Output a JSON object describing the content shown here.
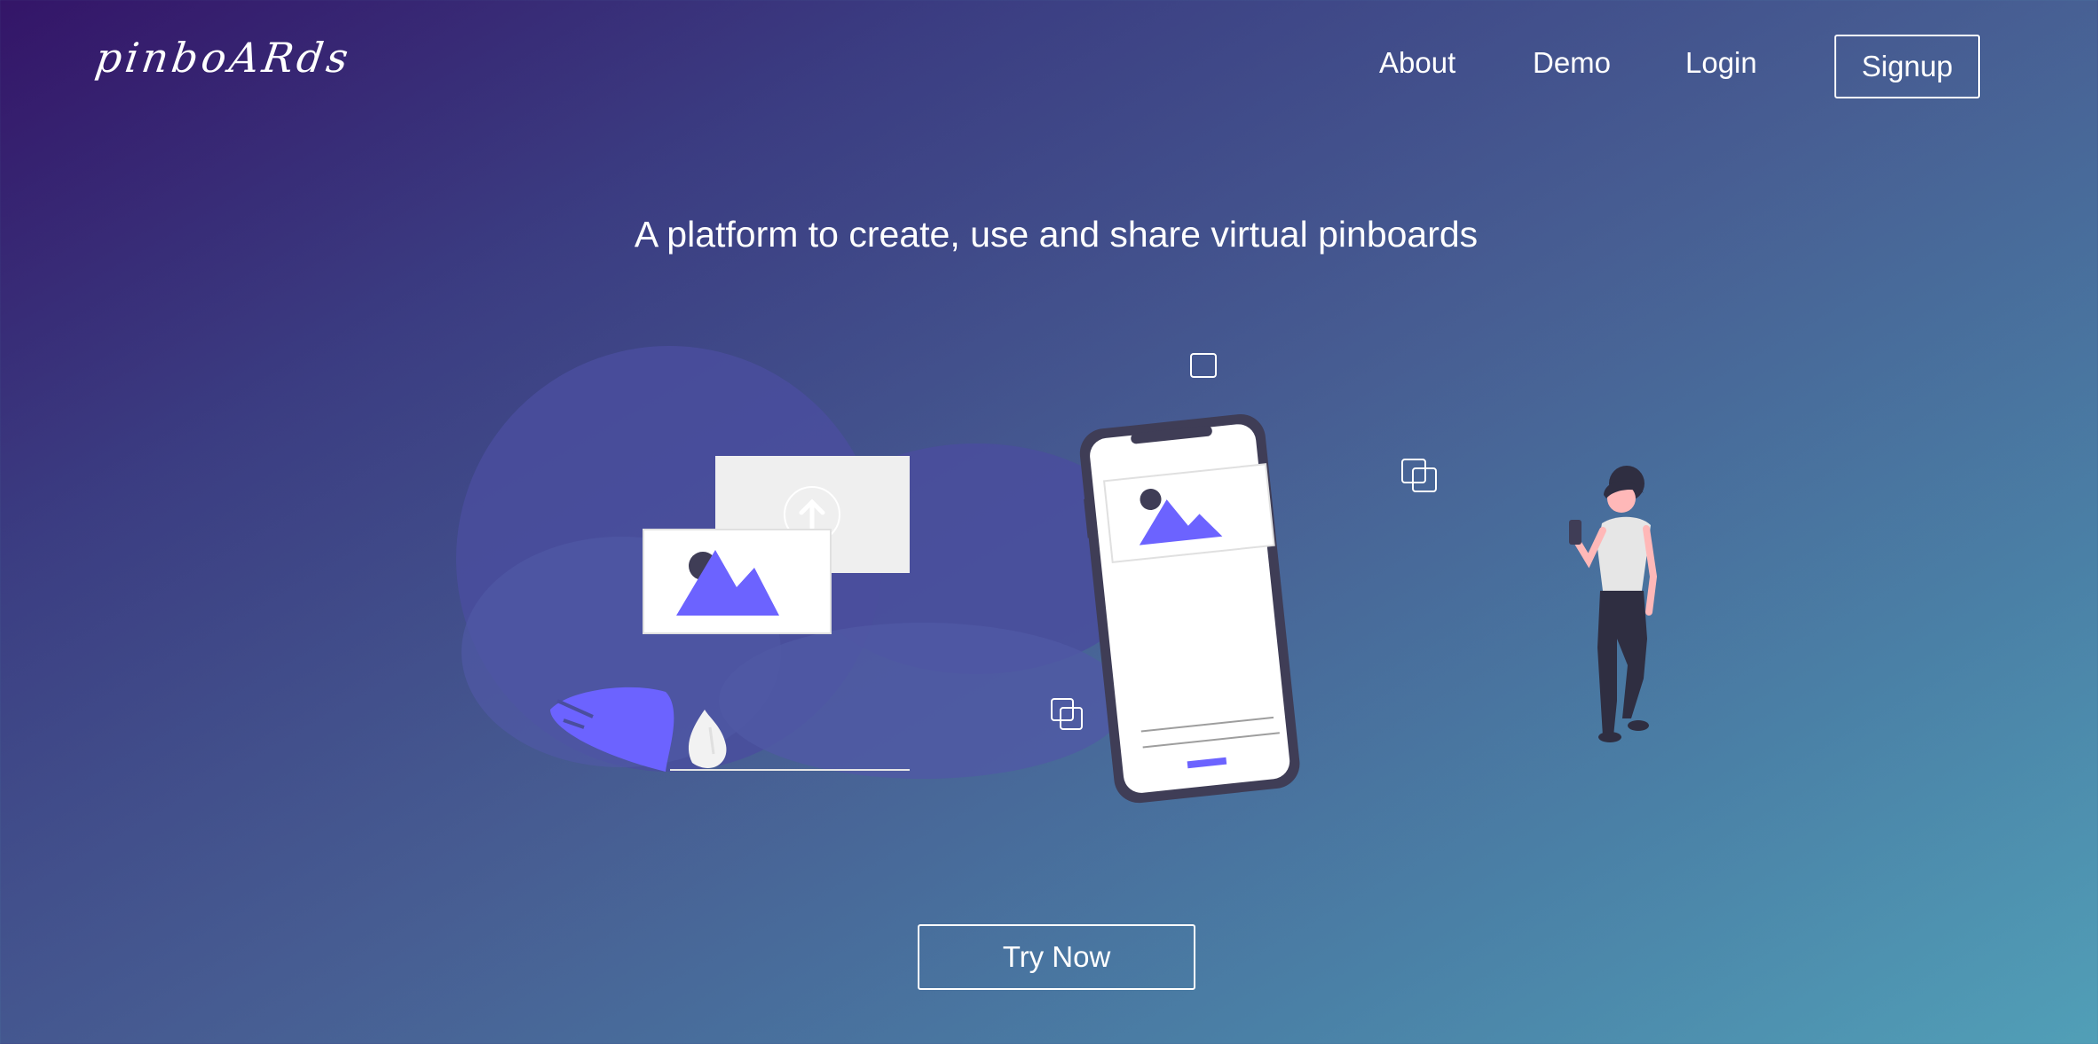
{
  "brand": {
    "logo_text": "pinboARds"
  },
  "nav": {
    "about": "About",
    "demo": "Demo",
    "login": "Login",
    "signup": "Signup"
  },
  "hero": {
    "headline": "A platform to create, use and share virtual pinboards",
    "cta": "Try Now"
  },
  "colors": {
    "accent": "#6c63ff",
    "gradient_start": "#341568",
    "gradient_end": "#519fb7",
    "text": "#ffffff"
  },
  "illustration": {
    "icons": [
      "upload-icon",
      "image-icon",
      "copy-icon",
      "square-icon",
      "plant-icon",
      "person-figure"
    ]
  }
}
